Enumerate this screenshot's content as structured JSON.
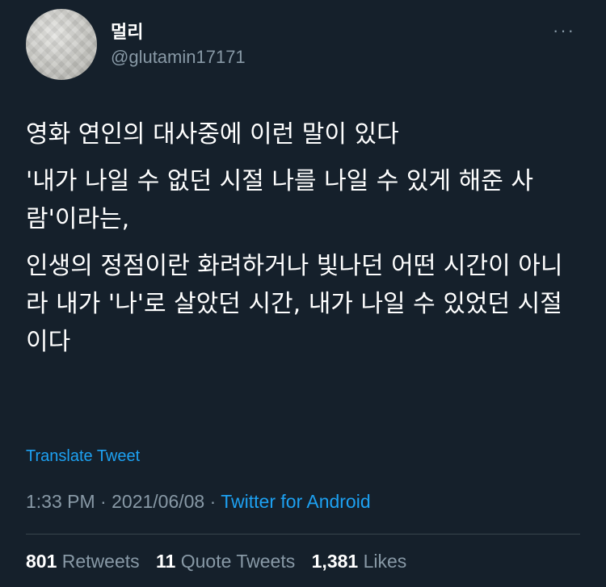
{
  "author": {
    "display_name": "멀리",
    "handle": "@glutamin17171"
  },
  "menu": {
    "more_label": "···"
  },
  "tweet": {
    "paragraphs": [
      "영화 연인의 대사중에 이런 말이 있다",
      "'내가 나일 수 없던 시절 나를 나일 수 있게 해준 사람'이라는,",
      "인생의 정점이란 화려하거나 빛나던 어떤 시간이 아니라 내가 '나'로 살았던 시간, 내가 나일 수 있었던 시절이다"
    ]
  },
  "translate_label": "Translate Tweet",
  "meta": {
    "time": "1:33 PM",
    "separator": " · ",
    "date": "2021/06/08",
    "separator2": " · ",
    "source": "Twitter for Android"
  },
  "stats": {
    "retweets": {
      "count": "801",
      "label": "Retweets"
    },
    "quote_tweets": {
      "count": "11",
      "label": "Quote Tweets"
    },
    "likes": {
      "count": "1,381",
      "label": "Likes"
    }
  },
  "colors": {
    "background": "#15202b",
    "accent": "#1da1f2",
    "secondary_text": "#8899a6",
    "divider": "#38444d"
  }
}
